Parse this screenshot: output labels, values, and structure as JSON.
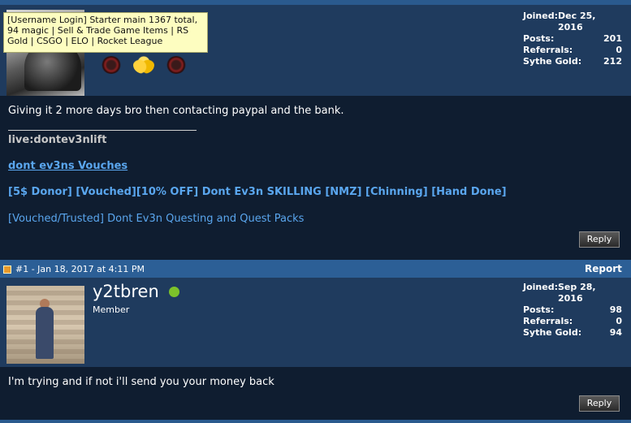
{
  "post1": {
    "tooltip": "[Username Login] Starter main 1367 total, 94 magic | Sell & Trade Game Items | RS Gold | CSGO | ELO | Rocket League",
    "icons": [
      "rank-ring-icon",
      "gold-coins-icon",
      "rank-ring-icon"
    ],
    "stats": {
      "joined_label": "Joined:",
      "joined": "Dec 25, 2016",
      "posts_label": "Posts:",
      "posts": "201",
      "referrals_label": "Referrals:",
      "referrals": "0",
      "gold_label": "Sythe Gold:",
      "gold": "212"
    },
    "message": "Giving it 2 more days bro then contacting paypal and the bank.",
    "signature": {
      "live": "live:dontev3nlift",
      "vouches": "dont ev3ns Vouches",
      "skilling": "[5$ Donor] [Vouched][10% OFF] Dont Ev3n SKILLING [NMZ] [Chinning] [Hand Done]",
      "quest": "[Vouched/Trusted] Dont Ev3n Questing and Quest Packs"
    },
    "reply_label": "Reply"
  },
  "post2": {
    "meta": "#1 - Jan 18, 2017 at 4:11 PM",
    "report_label": "Report",
    "username": "y2tbren",
    "rank": "Member",
    "stats": {
      "joined_label": "Joined:",
      "joined": "Sep 28, 2016",
      "posts_label": "Posts:",
      "posts": "98",
      "referrals_label": "Referrals:",
      "referrals": "0",
      "gold_label": "Sythe Gold:",
      "gold": "94"
    },
    "message": "I'm trying and if not i'll send you your money back",
    "reply_label": "Reply"
  },
  "colors": {
    "header": "#2c5f96",
    "userbar": "#1f3b5e",
    "body": "#0f1d30",
    "link": "#5aa6ee",
    "online": "#7cc22a"
  }
}
